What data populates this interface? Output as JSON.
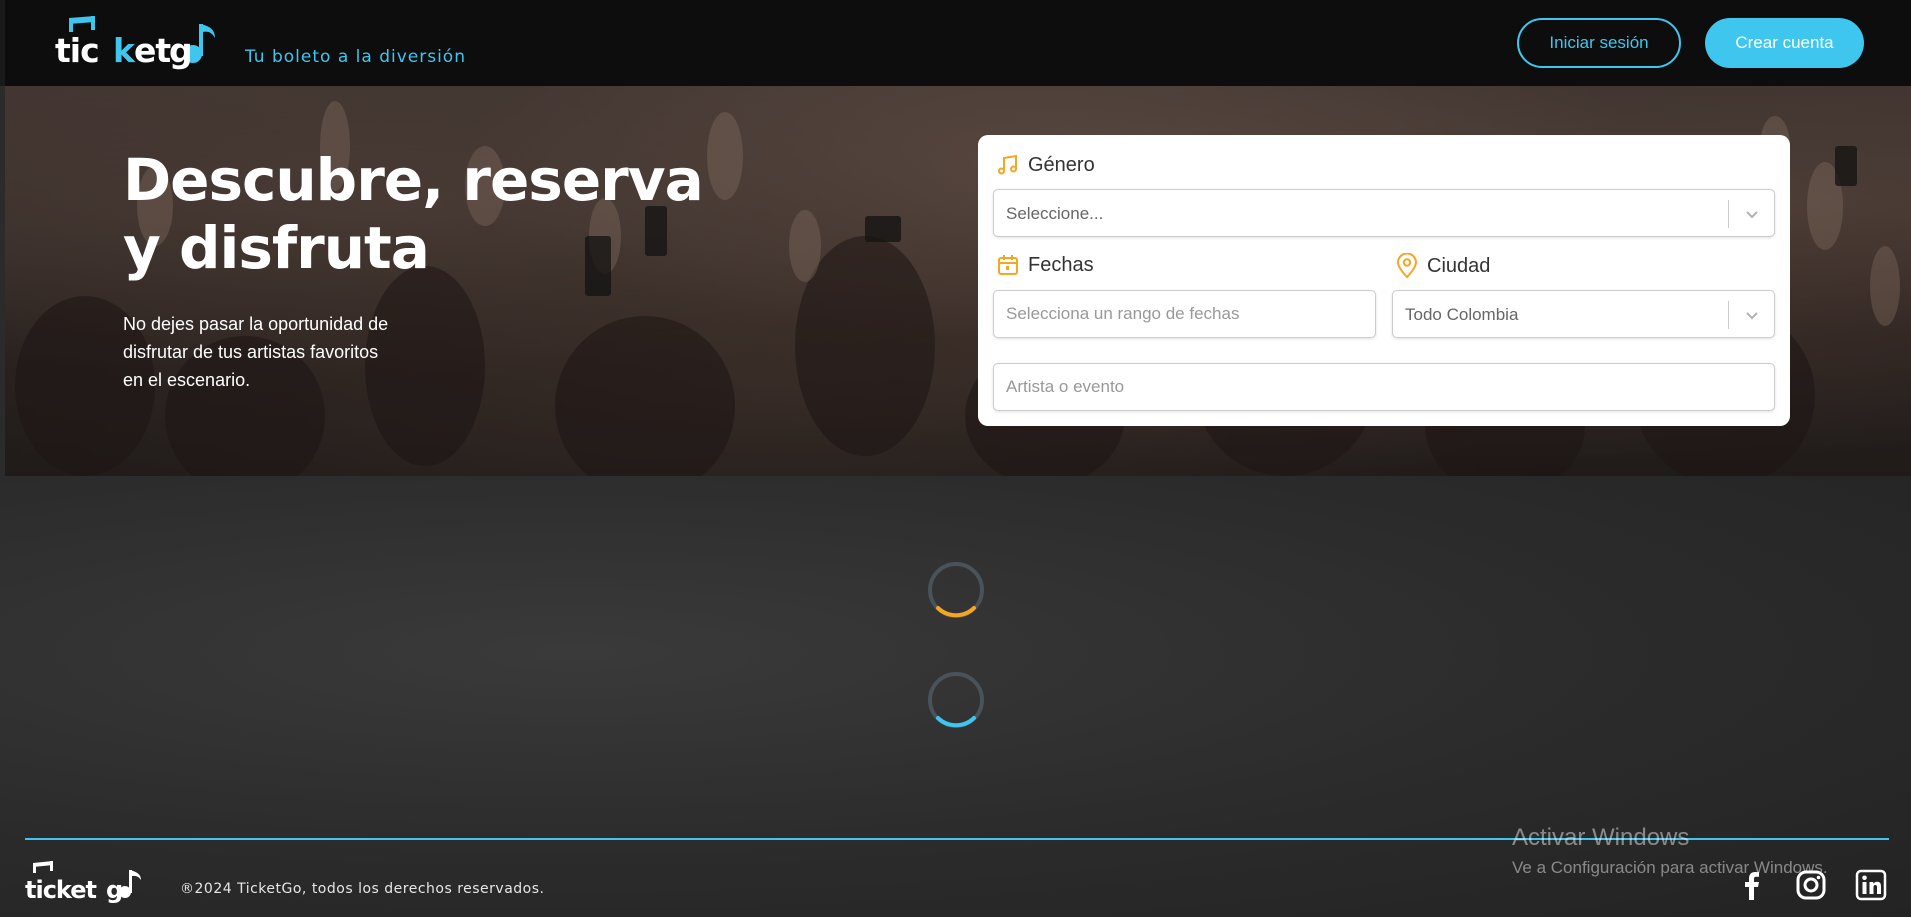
{
  "header": {
    "logo_text": "ticket go",
    "tagline": "Tu boleto a la diversión",
    "login_label": "Iniciar sesión",
    "signup_label": "Crear cuenta"
  },
  "hero": {
    "title_line1": "Descubre, reserva",
    "title_line2": "y disfruta",
    "subtitle_line1": "No dejes pasar la oportunidad de",
    "subtitle_line2": "disfrutar de tus artistas favoritos",
    "subtitle_line3": "en el escenario."
  },
  "search": {
    "genre_label": "Género",
    "genre_value": "Seleccione...",
    "dates_label": "Fechas",
    "dates_placeholder": "Selecciona un rango de fechas",
    "city_label": "Ciudad",
    "city_value": "Todo Colombia",
    "artist_placeholder": "Artista o evento"
  },
  "footer": {
    "logo_text": "ticket go",
    "copyright": "®2024 TicketGo, todos los derechos reservados.",
    "social_icons": [
      "facebook-icon",
      "instagram-icon",
      "linkedin-icon"
    ]
  },
  "watermark": {
    "title": "Activar Windows",
    "subtitle": "Ve a Configuración para activar Windows."
  },
  "colors": {
    "accent": "#3ec6ee",
    "icon_accent": "#f5a623",
    "header_bg": "#0d0d0e",
    "content_bg": "#2b2b2b"
  }
}
